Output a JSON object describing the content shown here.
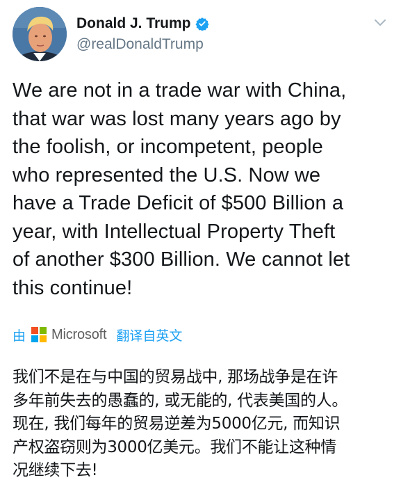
{
  "user": {
    "display_name": "Donald J. Trump",
    "handle": "@realDonaldTrump",
    "verified_icon": "verified-badge-icon"
  },
  "tweet": {
    "lines": [
      "We are not in a trade war with China,",
      "that war was lost many years ago by",
      "the foolish, or incompetent, people",
      "who represented the U.S. Now we",
      "have a Trade Deficit of $500 Billion a",
      "year, with Intellectual Property Theft",
      "of another $300 Billion. We cannot let",
      "this continue!"
    ]
  },
  "translation": {
    "by_label": "由",
    "provider": "Microsoft",
    "action_label": "翻译自英文",
    "lines": [
      "我们不是在与中国的贸易战中, 那场战争是在许",
      "多年前失去的愚蠢的, 或无能的, 代表美国的人。",
      "现在, 我们每年的贸易逆差为5000亿元, 而知识",
      "产权盗窃则为3000亿美元。我们不能让这种情",
      "况继续下去!"
    ]
  },
  "colors": {
    "link_blue": "#1da1f2",
    "handle_gray": "#657786",
    "text": "#14171a",
    "ms_red": "#f25022",
    "ms_green": "#7fba00",
    "ms_blue": "#00a4ef",
    "ms_yellow": "#ffb900"
  }
}
